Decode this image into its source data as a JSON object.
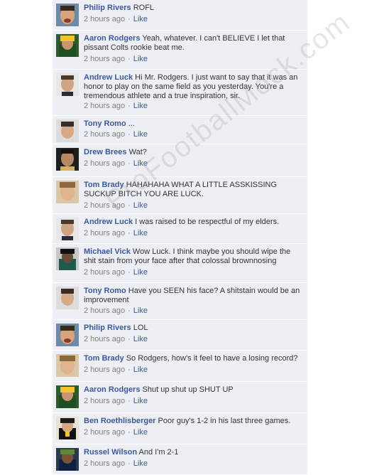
{
  "watermark": "ProFootballMock.com",
  "comments": [
    {
      "author": "Philip Rivers",
      "text": "ROFL",
      "time": "2 hours ago",
      "like": "Like",
      "avatar": "philip-rivers-avatar"
    },
    {
      "author": "Aaron Rodgers",
      "text": "Yeah, whatever. I can't BELIEVE I let that pissant Colts rookie beat me.",
      "time": "2 hours ago",
      "like": "Like",
      "avatar": "aaron-rodgers-avatar"
    },
    {
      "author": "Andrew Luck",
      "text": "Hi Mr. Rodgers. I just want to say that it was an honor to play on the same field as you yesterday. You're a tremendous athlete and a true inspiration, sir.",
      "time": "2 hours ago",
      "like": "Like",
      "avatar": "andrew-luck-avatar"
    },
    {
      "author": "Tony Romo",
      "text": "...",
      "time": "2 hours ago",
      "like": "Like",
      "avatar": "tony-romo-avatar"
    },
    {
      "author": "Drew Brees",
      "text": "Wat?",
      "time": "2 hours ago",
      "like": "Like",
      "avatar": "drew-brees-avatar"
    },
    {
      "author": "Tom Brady",
      "text": "HAHAHAHA WHAT A LITTLE ASSKISSING SUCKUP BITCH YOU ARE LUCK.",
      "time": "2 hours ago",
      "like": "Like",
      "avatar": "tom-brady-avatar"
    },
    {
      "author": "Andrew Luck",
      "text": "I was raised to be respectful of my elders.",
      "time": "2 hours ago",
      "like": "Like",
      "avatar": "andrew-luck-avatar"
    },
    {
      "author": "Michael Vick",
      "text": "Wow Luck. I think maybe you should wipe the shit stain from your face after that colossal brownnosing",
      "time": "2 hours ago",
      "like": "Like",
      "avatar": "michael-vick-avatar"
    },
    {
      "author": "Tony Romo",
      "text": "Have you SEEN his face? A shitstain would be an improvement",
      "time": "2 hours ago",
      "like": "Like",
      "avatar": "tony-romo-avatar"
    },
    {
      "author": "Philip Rivers",
      "text": "LOL",
      "time": "2 hours ago",
      "like": "Like",
      "avatar": "philip-rivers-avatar"
    },
    {
      "author": "Tom Brady",
      "text": "So Rodgers, how's it feel to have a losing record?",
      "time": "2 hours ago",
      "like": "Like",
      "avatar": "tom-brady-avatar"
    },
    {
      "author": "Aaron Rodgers",
      "text": "Shut up shut up SHUT UP",
      "time": "2 hours ago",
      "like": "Like",
      "avatar": "aaron-rodgers-avatar"
    },
    {
      "author": "Ben Roethlisberger",
      "text": "Poor guy's 1-2 in his last three games.",
      "time": "2 hours ago",
      "like": "Like",
      "avatar": "ben-roethlisberger-avatar"
    },
    {
      "author": "Russel Wilson",
      "text": "And I'm 2-1",
      "time": "2 hours ago",
      "like": "Like",
      "avatar": "russel-wilson-avatar"
    }
  ]
}
